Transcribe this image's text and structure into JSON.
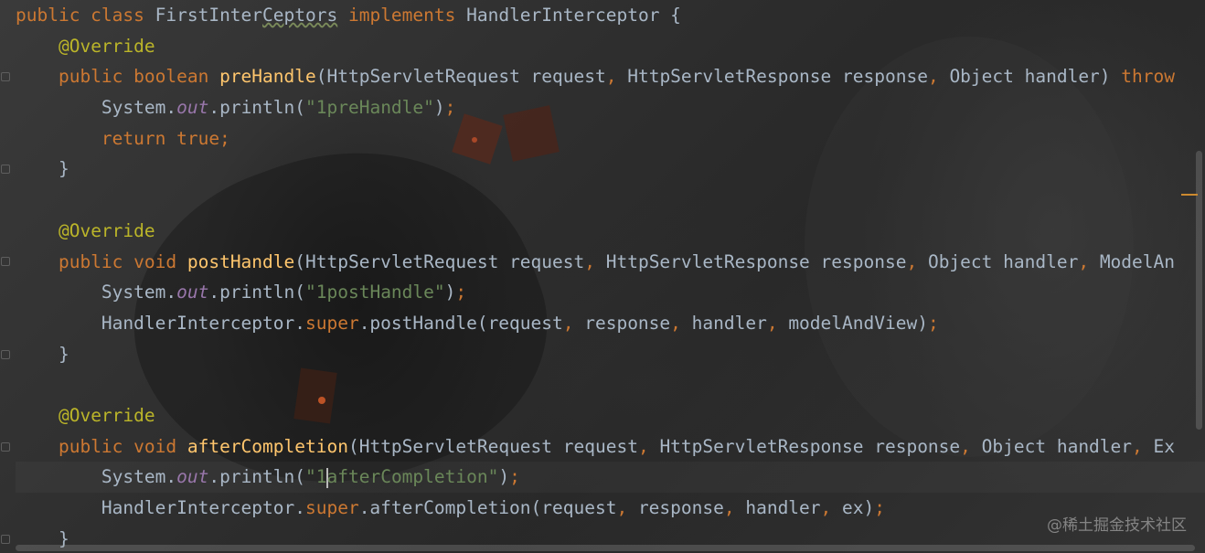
{
  "editor": {
    "lines": [
      [
        {
          "cls": "t-kw",
          "text": "public class "
        },
        {
          "cls": "t-plain",
          "text": "FirstInter"
        },
        {
          "cls": "t-plain t-squiggle",
          "text": "Ceptors"
        },
        {
          "cls": "t-plain",
          "text": " "
        },
        {
          "cls": "t-kw",
          "text": "implements "
        },
        {
          "cls": "t-plain",
          "text": "HandlerInterceptor {"
        }
      ],
      [
        {
          "cls": "t-plain",
          "text": "    "
        },
        {
          "cls": "t-ann",
          "text": "@Override"
        }
      ],
      [
        {
          "cls": "t-plain",
          "text": "    "
        },
        {
          "cls": "t-kw",
          "text": "public boolean "
        },
        {
          "cls": "t-fn",
          "text": "preHandle"
        },
        {
          "cls": "t-plain",
          "text": "(HttpServletRequest request"
        },
        {
          "cls": "t-kw",
          "text": ", "
        },
        {
          "cls": "t-plain",
          "text": "HttpServletResponse response"
        },
        {
          "cls": "t-kw",
          "text": ", "
        },
        {
          "cls": "t-plain",
          "text": "Object handler) "
        },
        {
          "cls": "t-kw",
          "text": "throw"
        }
      ],
      [
        {
          "cls": "t-plain",
          "text": "        System."
        },
        {
          "cls": "t-out",
          "text": "out"
        },
        {
          "cls": "t-plain",
          "text": ".println("
        },
        {
          "cls": "t-str",
          "text": "\"1preHandle\""
        },
        {
          "cls": "t-plain",
          "text": ")"
        },
        {
          "cls": "t-kw",
          "text": ";"
        }
      ],
      [
        {
          "cls": "t-plain",
          "text": "        "
        },
        {
          "cls": "t-kw",
          "text": "return true;"
        }
      ],
      [
        {
          "cls": "t-plain",
          "text": "    }"
        }
      ],
      [],
      [
        {
          "cls": "t-plain",
          "text": "    "
        },
        {
          "cls": "t-ann",
          "text": "@Override"
        }
      ],
      [
        {
          "cls": "t-plain",
          "text": "    "
        },
        {
          "cls": "t-kw",
          "text": "public void "
        },
        {
          "cls": "t-fn",
          "text": "postHandle"
        },
        {
          "cls": "t-plain",
          "text": "(HttpServletRequest request"
        },
        {
          "cls": "t-kw",
          "text": ", "
        },
        {
          "cls": "t-plain",
          "text": "HttpServletResponse response"
        },
        {
          "cls": "t-kw",
          "text": ", "
        },
        {
          "cls": "t-plain",
          "text": "Object handler"
        },
        {
          "cls": "t-kw",
          "text": ", "
        },
        {
          "cls": "t-plain",
          "text": "ModelAn"
        }
      ],
      [
        {
          "cls": "t-plain",
          "text": "        System."
        },
        {
          "cls": "t-out",
          "text": "out"
        },
        {
          "cls": "t-plain",
          "text": ".println("
        },
        {
          "cls": "t-str",
          "text": "\"1postHandle\""
        },
        {
          "cls": "t-plain",
          "text": ")"
        },
        {
          "cls": "t-kw",
          "text": ";"
        }
      ],
      [
        {
          "cls": "t-plain",
          "text": "        HandlerInterceptor."
        },
        {
          "cls": "t-kw",
          "text": "super"
        },
        {
          "cls": "t-plain",
          "text": ".postHandle(request"
        },
        {
          "cls": "t-kw",
          "text": ", "
        },
        {
          "cls": "t-plain",
          "text": "response"
        },
        {
          "cls": "t-kw",
          "text": ", "
        },
        {
          "cls": "t-plain",
          "text": "handler"
        },
        {
          "cls": "t-kw",
          "text": ", "
        },
        {
          "cls": "t-plain",
          "text": "modelAndView)"
        },
        {
          "cls": "t-kw",
          "text": ";"
        }
      ],
      [
        {
          "cls": "t-plain",
          "text": "    }"
        }
      ],
      [],
      [
        {
          "cls": "t-plain",
          "text": "    "
        },
        {
          "cls": "t-ann",
          "text": "@Override"
        }
      ],
      [
        {
          "cls": "t-plain",
          "text": "    "
        },
        {
          "cls": "t-kw",
          "text": "public void "
        },
        {
          "cls": "t-fn",
          "text": "afterCompletion"
        },
        {
          "cls": "t-plain",
          "text": "(HttpServletRequest request"
        },
        {
          "cls": "t-kw",
          "text": ", "
        },
        {
          "cls": "t-plain",
          "text": "HttpServletResponse response"
        },
        {
          "cls": "t-kw",
          "text": ", "
        },
        {
          "cls": "t-plain",
          "text": "Object handler"
        },
        {
          "cls": "t-kw",
          "text": ", "
        },
        {
          "cls": "t-plain",
          "text": "Ex"
        }
      ],
      [
        {
          "cls": "t-plain",
          "text": "        System."
        },
        {
          "cls": "t-out",
          "text": "out"
        },
        {
          "cls": "t-plain",
          "text": ".println("
        },
        {
          "cls": "t-str",
          "text": "\"1"
        },
        {
          "cls": "caret",
          "text": ""
        },
        {
          "cls": "t-str",
          "text": "afterCompletion\""
        },
        {
          "cls": "t-plain",
          "text": ")"
        },
        {
          "cls": "t-kw",
          "text": ";"
        }
      ],
      [
        {
          "cls": "t-plain",
          "text": "        HandlerInterceptor."
        },
        {
          "cls": "t-kw",
          "text": "super"
        },
        {
          "cls": "t-plain",
          "text": ".afterCompletion(request"
        },
        {
          "cls": "t-kw",
          "text": ", "
        },
        {
          "cls": "t-plain",
          "text": "response"
        },
        {
          "cls": "t-kw",
          "text": ", "
        },
        {
          "cls": "t-plain",
          "text": "handler"
        },
        {
          "cls": "t-kw",
          "text": ", "
        },
        {
          "cls": "t-plain",
          "text": "ex)"
        },
        {
          "cls": "t-kw",
          "text": ";"
        }
      ],
      [
        {
          "cls": "t-plain",
          "text": "    }"
        }
      ]
    ],
    "current_line_index": 15,
    "fold_markers_at_lines": [
      2,
      5,
      8,
      11,
      14,
      17
    ]
  },
  "watermark": {
    "text": "@稀土掘金技术社区"
  },
  "colors": {
    "keyword": "#cc7832",
    "annotation": "#bbb529",
    "function": "#ffc66d",
    "string": "#6a8759",
    "static_field": "#9876aa",
    "plain": "#a9b7c6"
  }
}
